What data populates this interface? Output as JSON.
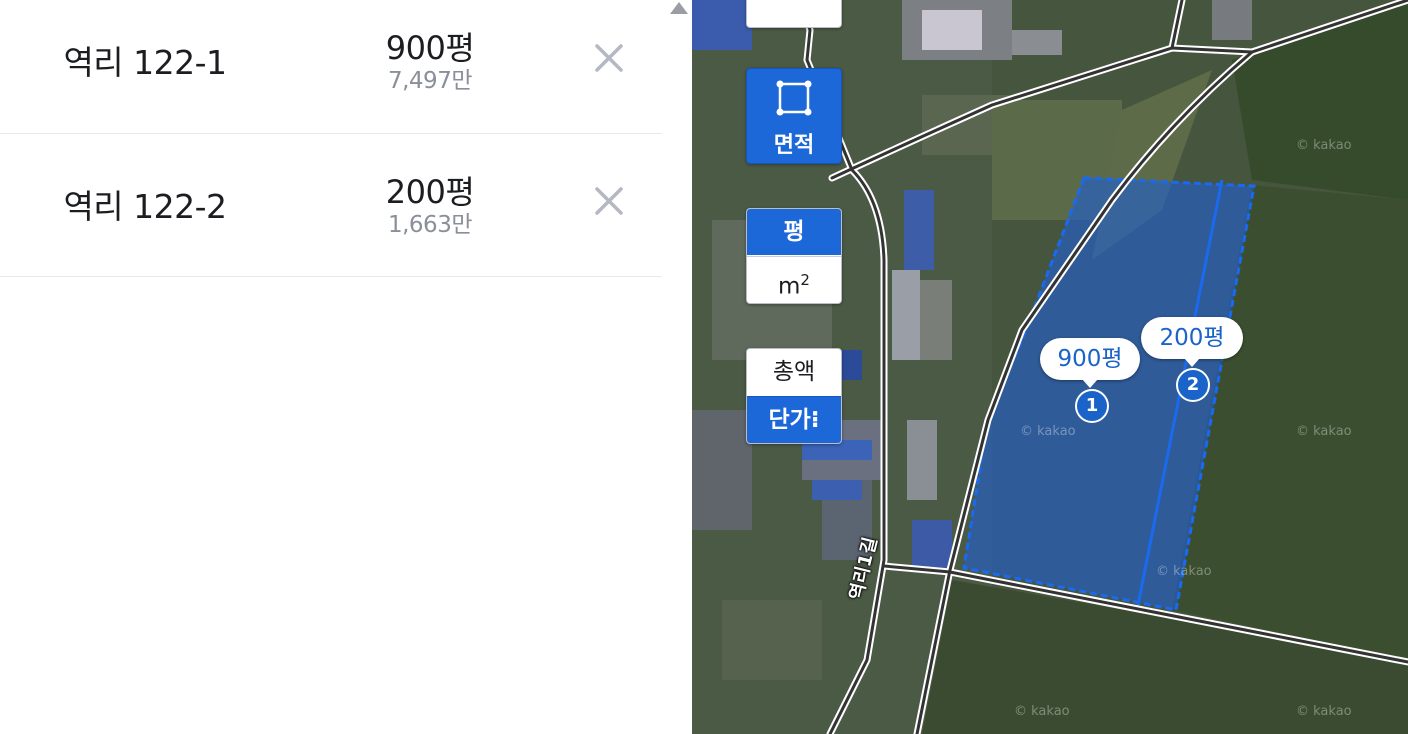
{
  "list": {
    "items": [
      {
        "address": "역리 122-1",
        "size": "900평",
        "price": "7,497만"
      },
      {
        "address": "역리 122-2",
        "size": "200평",
        "price": "1,663만"
      }
    ]
  },
  "map": {
    "area_button": {
      "label": "면적",
      "icon": "polygon-square-icon"
    },
    "unit_toggle": {
      "option1": "평",
      "option2_base": "m",
      "option2_sup": "2",
      "selected": "평"
    },
    "price_toggle": {
      "option1": "총액",
      "option2": "단가⁝",
      "selected": "단가"
    },
    "parcels": [
      {
        "number": "1",
        "label": "900평"
      },
      {
        "number": "2",
        "label": "200평"
      }
    ],
    "road_label": "역리1길",
    "watermark": "© kakao"
  },
  "colors": {
    "accent": "#1c68d9",
    "bubble_text": "#1a63c9",
    "parcel_fill": "#1f5fd6"
  }
}
